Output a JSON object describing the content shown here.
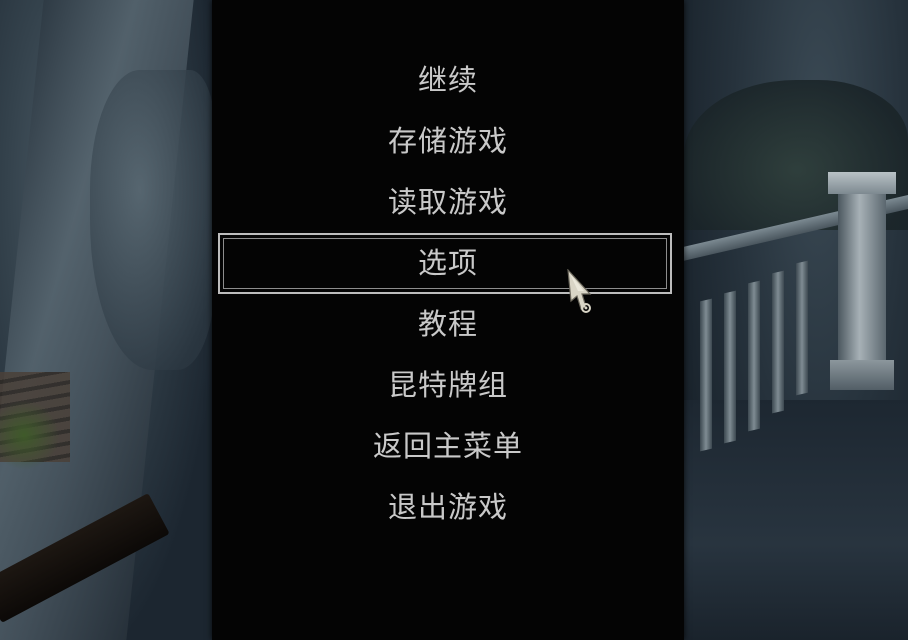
{
  "menu": {
    "items": [
      {
        "label": "继续",
        "selected": false
      },
      {
        "label": "存储游戏",
        "selected": false
      },
      {
        "label": "读取游戏",
        "selected": false
      },
      {
        "label": "选项",
        "selected": true
      },
      {
        "label": "教程",
        "selected": false
      },
      {
        "label": "昆特牌组",
        "selected": false
      },
      {
        "label": "返回主菜单",
        "selected": false
      },
      {
        "label": "退出游戏",
        "selected": false
      }
    ]
  },
  "colors": {
    "panel": "#040404",
    "text": "#c9c9c9",
    "selection_frame": "#bdbdbd"
  },
  "icons": {
    "cursor": "mouse-pointer-icon"
  }
}
